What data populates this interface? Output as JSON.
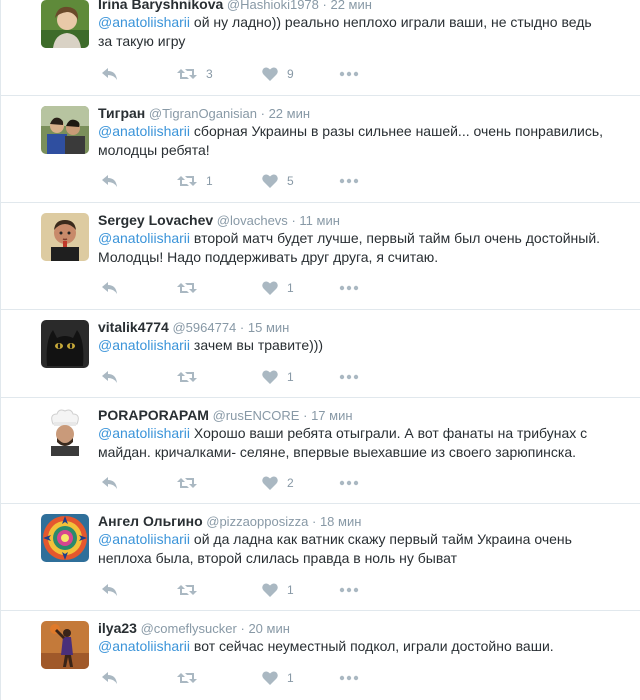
{
  "tweets": [
    {
      "name": "Irina Baryshnikova",
      "handle": "@Hashioki1978",
      "dot": "·",
      "time": "22 мин",
      "mention": "@anatoliisharii",
      "text": " ой ну ладно)) реально неплохо играли ваши, не стыдно ведь за такую игру",
      "retweets": "3",
      "likes": "9",
      "avatar": "avatar-woman-green"
    },
    {
      "name": "Тигран",
      "handle": "@TigranOganisian",
      "dot": "·",
      "time": "22 мин",
      "mention": "@anatoliisharii",
      "text": " сборная Украины в разы сильнее нашей... очень понравились, молодцы ребята!",
      "retweets": "1",
      "likes": "5",
      "avatar": "avatar-couple"
    },
    {
      "name": "Sergey Lovachev",
      "handle": "@lovachevs",
      "dot": "·",
      "time": "11 мин",
      "mention": "@anatoliisharii",
      "text": " второй матч будет лучше, первый тайм был очень достойный. Молодцы! Надо поддерживать друг друга, я считаю.",
      "retweets": "",
      "likes": "1",
      "avatar": "avatar-man"
    },
    {
      "name": "vitalik4774",
      "handle": "@5964774",
      "dot": "·",
      "time": "15 мин",
      "mention": "@anatoliisharii",
      "text": " зачем вы травите)))",
      "retweets": "",
      "likes": "1",
      "avatar": "avatar-cat"
    },
    {
      "name": "PORAPORAPAM",
      "handle": "@rusENCORE",
      "dot": "·",
      "time": "17 мин",
      "mention": "@anatoliisharii",
      "text": " Хорошо ваши ребята отыграли. А вот фанаты на трибунах с майдан. кричалками- селяне, впервые выехавшие из своего зарюпинска.",
      "retweets": "",
      "likes": "2",
      "avatar": "avatar-chef"
    },
    {
      "name": "Ангел Ольгино",
      "handle": "@pizzaopposizza",
      "dot": "·",
      "time": "18 мин",
      "mention": "@anatoliisharii",
      "text": " ой да ладна как ватник скажу первый тайм Украина очень неплоха была, второй слилась правда в ноль ну быват",
      "retweets": "",
      "likes": "1",
      "avatar": "avatar-mandala"
    },
    {
      "name": "ilya23",
      "handle": "@comeflysucker",
      "dot": "·",
      "time": "20 мин",
      "mention": "@anatoliisharii",
      "text": " вот сейчас неуместный подкол, играли достойно ваши.",
      "retweets": "",
      "likes": "1",
      "avatar": "avatar-basketball"
    }
  ]
}
